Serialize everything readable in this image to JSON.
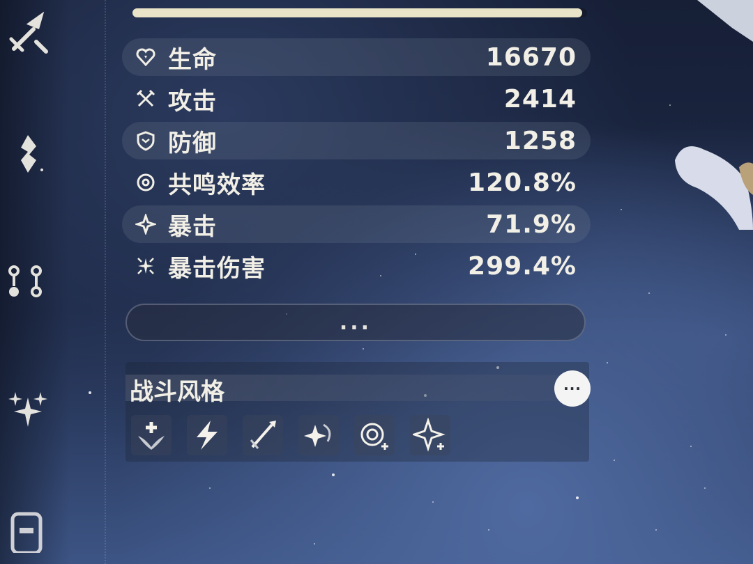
{
  "level": {
    "label": "",
    "progress": 0.99
  },
  "stats": [
    {
      "icon": "heart-icon",
      "label": "生命",
      "value": "16670"
    },
    {
      "icon": "attack-icon",
      "label": "攻击",
      "value": "2414"
    },
    {
      "icon": "shield-icon",
      "label": "防御",
      "value": "1258"
    },
    {
      "icon": "resonance-icon",
      "label": "共鸣效率",
      "value": "120.8%"
    },
    {
      "icon": "crit-rate-icon",
      "label": "暴击",
      "value": "71.9%"
    },
    {
      "icon": "crit-damage-icon",
      "label": "暴击伤害",
      "value": "299.4%"
    }
  ],
  "more_button": {
    "label": "..."
  },
  "combat_style": {
    "title": "战斗风格",
    "more_label": "···",
    "icons": [
      "healing-wings-icon",
      "lightning-icon",
      "sword-icon",
      "sparkle-swirl-icon",
      "spiral-plus-icon",
      "star-plus-icon"
    ]
  },
  "nav": [
    "weapon-icon",
    "echo-icon",
    "resonance-chain-icon",
    "forte-icon",
    "phone-icon"
  ],
  "colors": {
    "accent": "#e9e4c8",
    "text": "#f1efe6",
    "row_bg": "#3a4256"
  }
}
